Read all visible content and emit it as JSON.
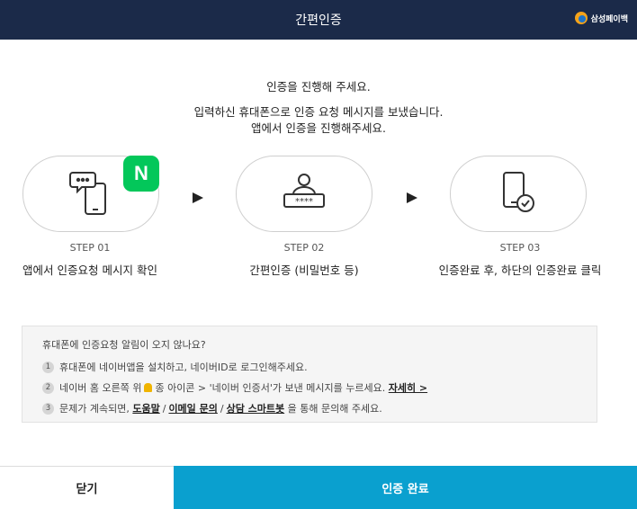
{
  "header": {
    "title": "간편인증",
    "brand_name": "삼성페이백",
    "brand_color": "#1b2a49"
  },
  "intro": {
    "line1": "인증을 진행해 주세요.",
    "line2": "입력하신 휴대폰으로 인증 요청 메시지를 보냈습니다.",
    "line3": "앱에서 인증을 진행해주세요."
  },
  "steps": [
    {
      "num": "STEP 01",
      "desc": "앱에서 인증요청 메시지 확인",
      "icon": "phone-chat-icon",
      "badge": "N"
    },
    {
      "num": "STEP 02",
      "desc": "간편인증 (비밀번호 등)",
      "icon": "password-user-icon"
    },
    {
      "num": "STEP 03",
      "desc": "인증완료 후, 하단의 인증완료 클릭",
      "icon": "phone-check-icon"
    }
  ],
  "help": {
    "question": "휴대폰에 인증요청 알림이 오지 않나요?",
    "items": [
      {
        "num": "1",
        "text": "휴대폰에 네이버앱을 설치하고, 네이버ID로 로그인해주세요."
      },
      {
        "num": "2",
        "text_a": "네이버 홈 오른쪽 위",
        "text_b": "종 아이콘 > '네이버 인증서'가 보낸 메시지를 누르세요.",
        "link": "자세히 >"
      },
      {
        "num": "3",
        "text_a": "문제가 계속되면,",
        "link1": "도움말",
        "sep1": "/",
        "link2": "이메일 문의",
        "sep2": "/",
        "link3": "상담 스마트봇",
        "text_b": "을 통해 문의해 주세요."
      }
    ]
  },
  "footer": {
    "close_label": "닫기",
    "confirm_label": "인증 완료",
    "confirm_color": "#0aa0cf"
  }
}
